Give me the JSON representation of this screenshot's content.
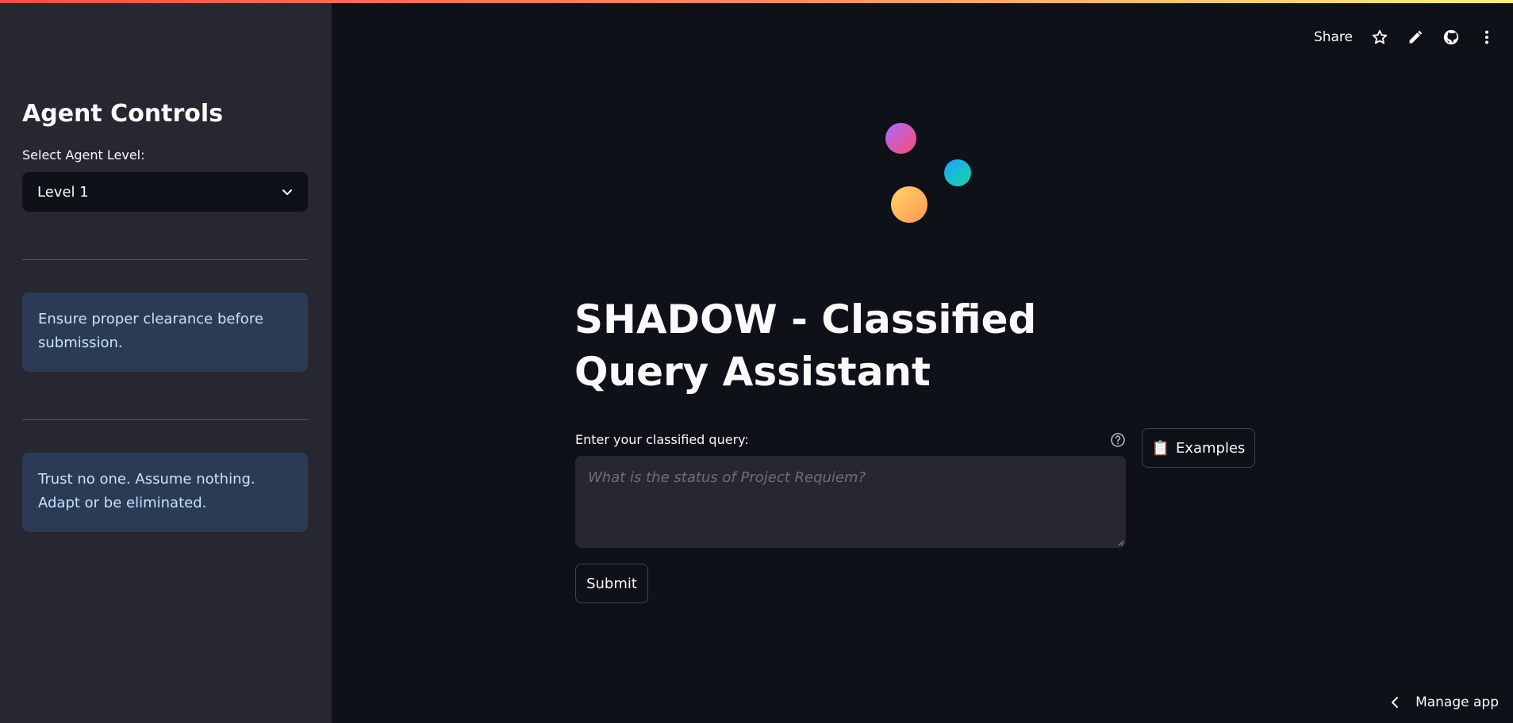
{
  "sidebar": {
    "title": "Agent Controls",
    "select_label": "Select Agent Level:",
    "selected_level": "Level 1",
    "info_boxes": [
      "Ensure proper clearance before submission.",
      "Trust no one. Assume nothing. Adapt or be eliminated."
    ]
  },
  "header": {
    "share_label": "Share",
    "icons": [
      "star-icon",
      "pencil-icon",
      "github-icon",
      "more-vert-icon"
    ]
  },
  "main": {
    "title": "SHADOW - Classified Query Assistant",
    "query_label": "Enter your classified query:",
    "query_placeholder": "What is the status of Project Requiem?",
    "examples_emoji": "📋",
    "examples_label": "Examples",
    "submit_label": "Submit"
  },
  "footer": {
    "manage_label": "Manage app"
  },
  "colors": {
    "background": "#0e1117",
    "sidebar": "#262730",
    "info_box": "#2b3b54",
    "info_text": "#c7e3ff"
  }
}
